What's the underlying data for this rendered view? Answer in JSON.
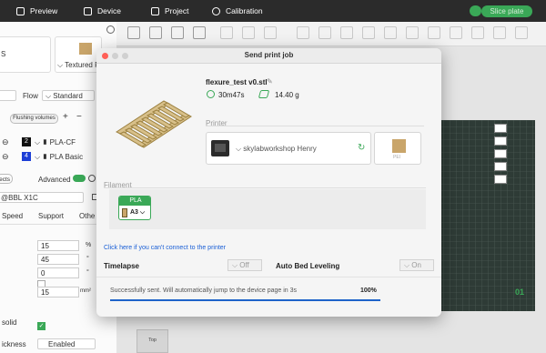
{
  "topbar": {
    "preview": "Preview",
    "device": "Device",
    "project": "Project",
    "calibration": "Calibration",
    "slice_plate": "Slice plate"
  },
  "left": {
    "printer_letter": "S",
    "plate_label": "Textured P",
    "flow_label": "Flow",
    "flow_value": "Standard",
    "flushing_volumes": "Flushing volumes",
    "filaments": [
      {
        "slot": "2",
        "name": "PLA-CF",
        "color": "#111111"
      },
      {
        "slot": "4",
        "name": "PLA Basic",
        "color": "#1d3fd6"
      }
    ],
    "objects_tab": "ects",
    "advanced": "Advanced",
    "printer_name": "@BBL X1C",
    "tabs": [
      "Speed",
      "Support",
      "Othe"
    ],
    "values": [
      "15",
      "45",
      "0",
      "",
      "15"
    ],
    "units": [
      "%",
      "°",
      "°",
      "",
      "mm²"
    ],
    "solid_label": "solid",
    "thickness_label": "ickness",
    "enabled_value": "Enabled"
  },
  "canvas": {
    "plate_number": "01",
    "top_label": "Top"
  },
  "dialog": {
    "title": "Send print job",
    "file_name": "flexure_test v0.stl",
    "time": "30m47s",
    "weight": "14.40 g",
    "printer_section": "Printer",
    "printer_name": "skylabworkshop Henry",
    "pei_label": "PEI",
    "filament_section": "Filament",
    "filament_type": "PLA",
    "filament_slot": "A3",
    "help_link": "Click here if you can't connect to the printer",
    "timelapse_label": "Timelapse",
    "timelapse_value": "Off",
    "bed_leveling_label": "Auto Bed Leveling",
    "bed_leveling_value": "On",
    "status_text": "Successfully sent. Will automatically jump to the device page in 3s",
    "progress_text": "100%",
    "progress": 1.0
  },
  "colors": {
    "accent": "#3aa857",
    "link": "#1a5fd6",
    "progress": "#1e63c9"
  }
}
